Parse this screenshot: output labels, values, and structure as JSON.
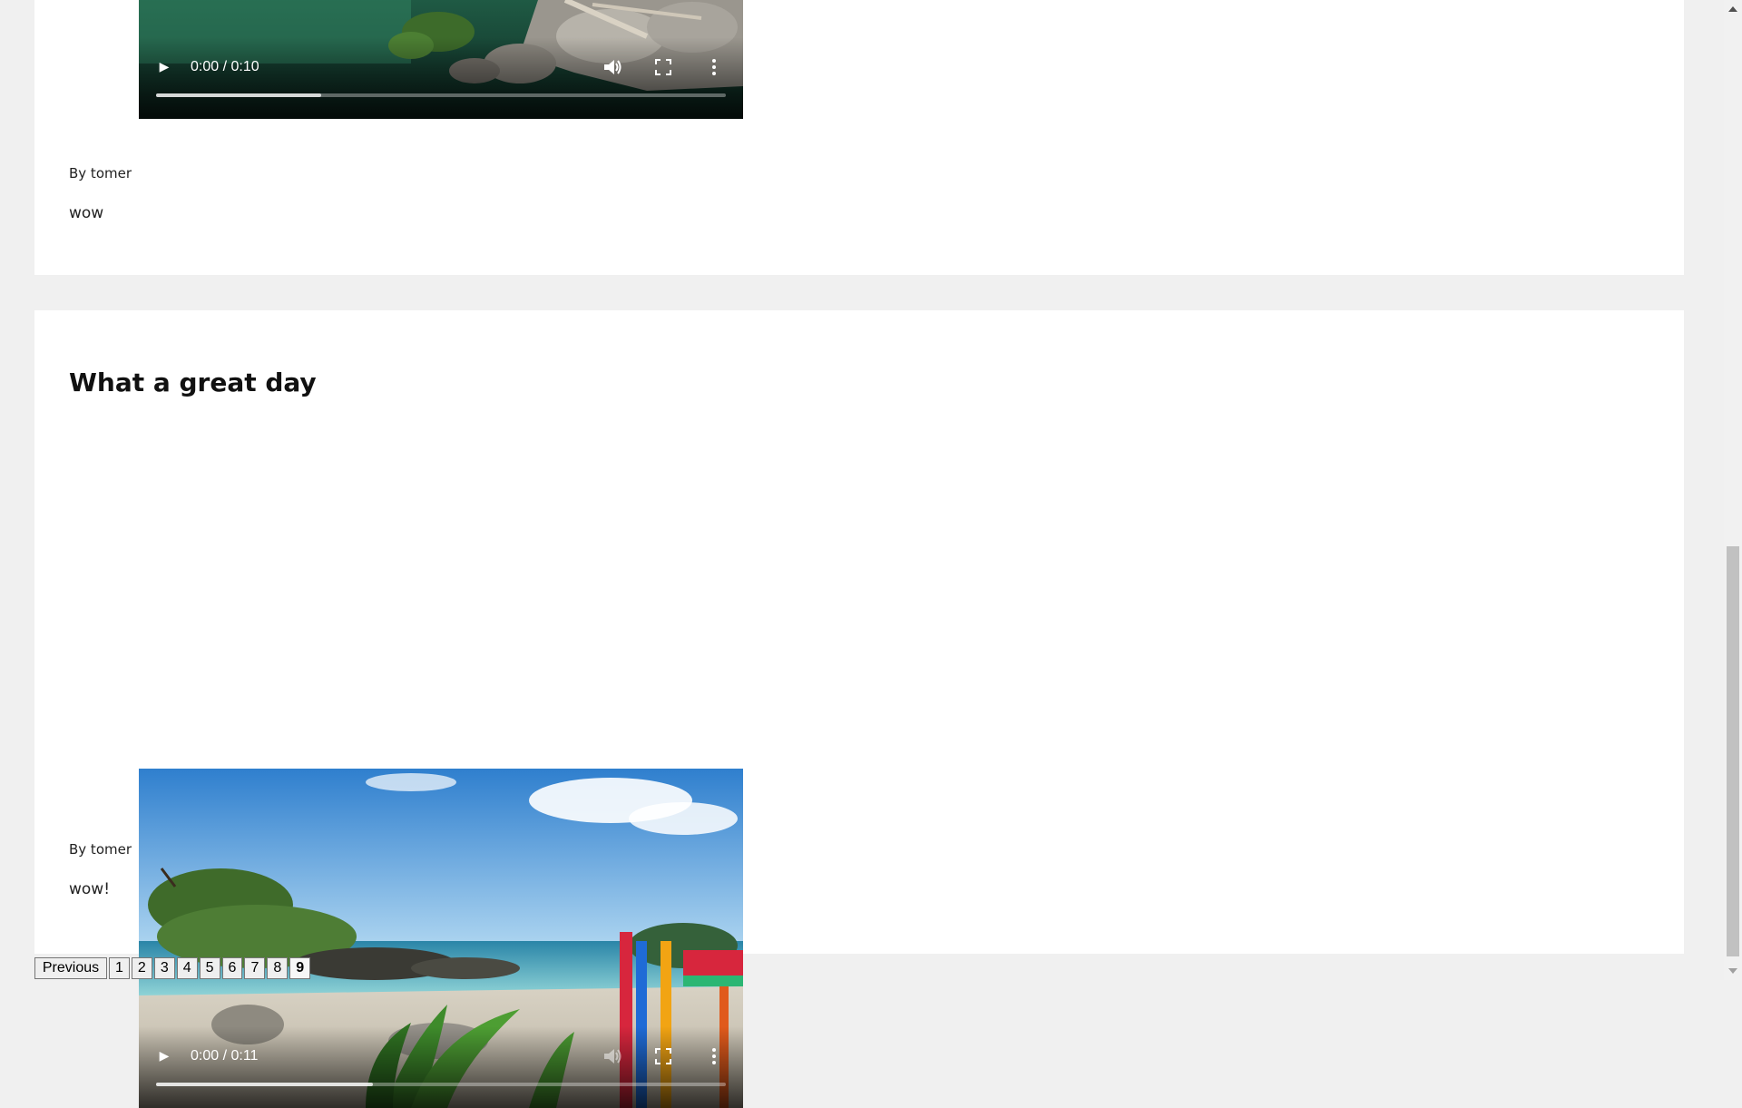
{
  "posts": [
    {
      "video": {
        "time": "0:00 / 0:10",
        "buffered": 0.29
      },
      "author": "By tomer",
      "body": "wow"
    },
    {
      "title": "What a great day",
      "video": {
        "time": "0:00 / 0:11",
        "buffered": 0.38
      },
      "author": "By tomer",
      "body": "wow!"
    }
  ],
  "pagination": {
    "previous_label": "Previous",
    "pages": [
      "1",
      "2",
      "3",
      "4",
      "5",
      "6",
      "7",
      "8",
      "9"
    ],
    "current": "9"
  },
  "icons": {
    "play": "play-icon",
    "volume": "volume-icon",
    "fullscreen": "fullscreen-icon",
    "more": "more-options-icon"
  }
}
